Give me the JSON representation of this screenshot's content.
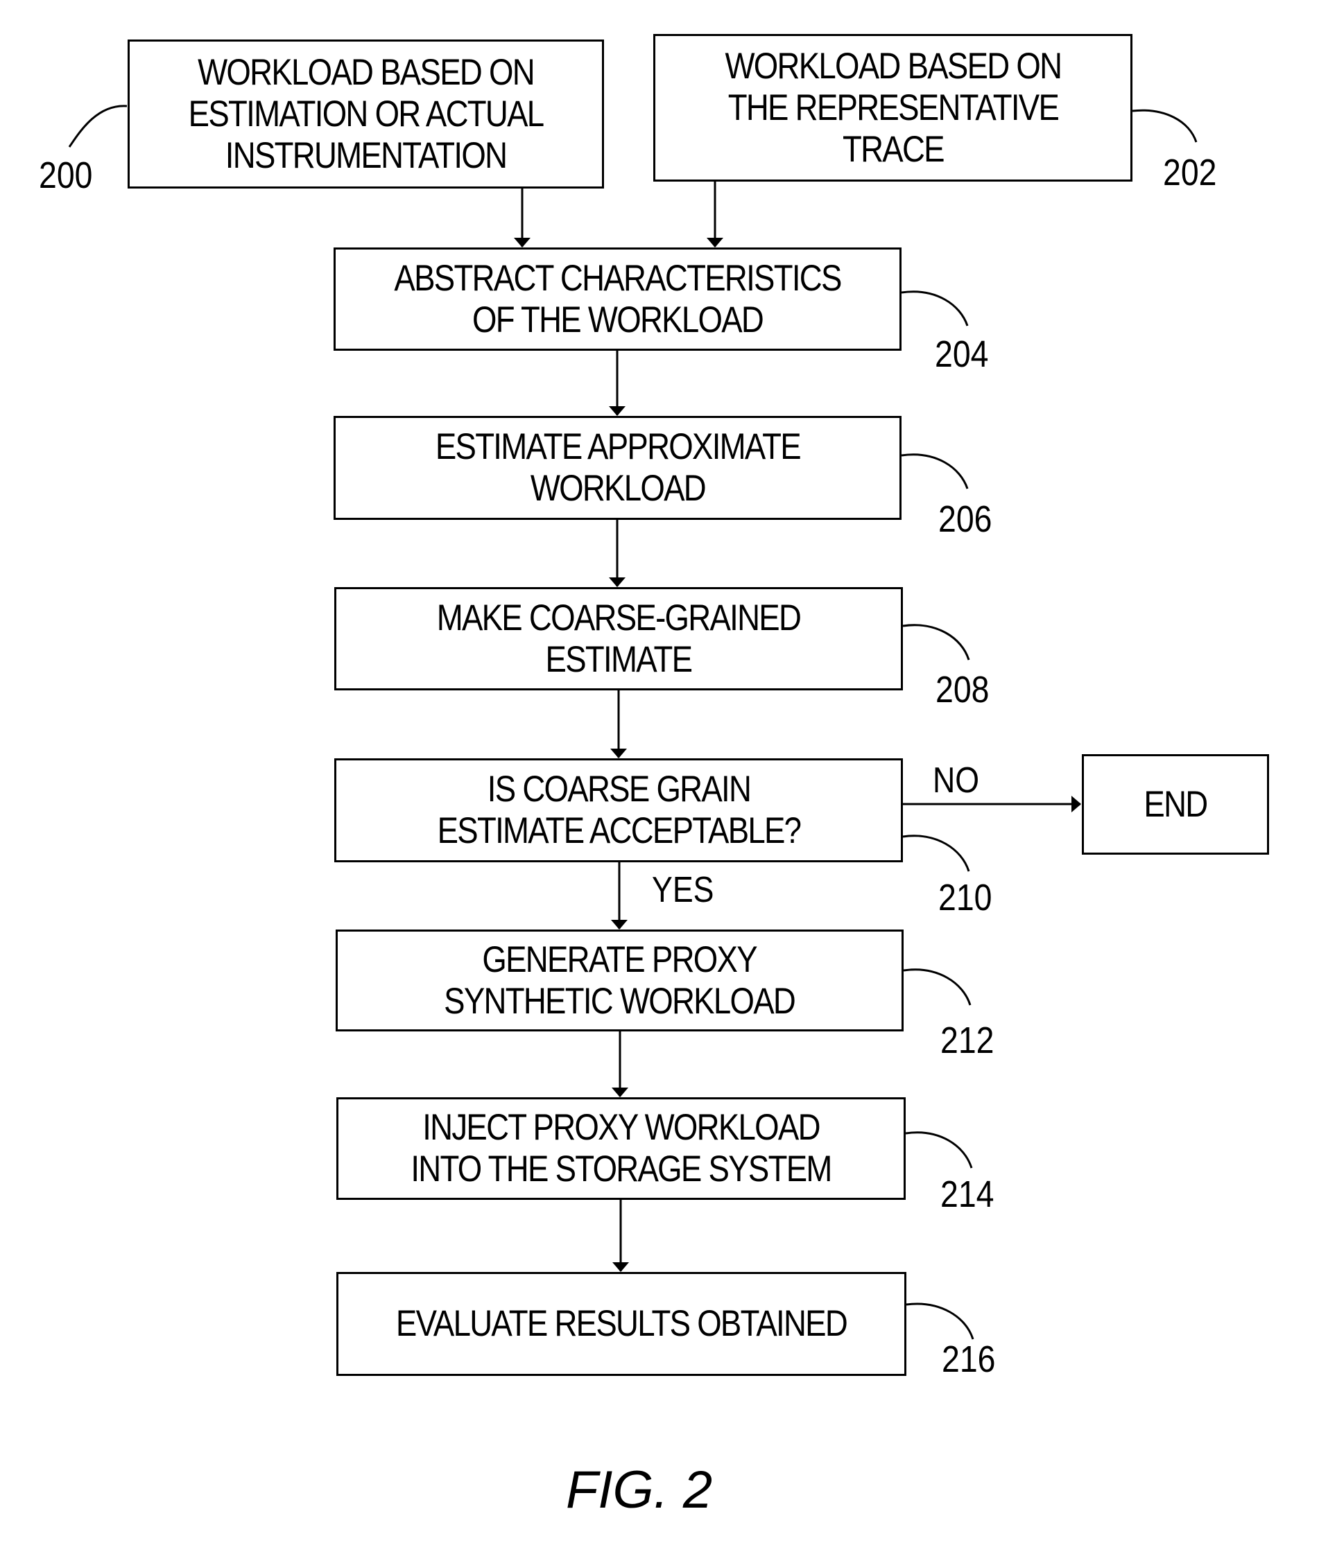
{
  "figure": {
    "caption": "FIG. 2"
  },
  "nodes": [
    {
      "id": "200",
      "label": "WORKLOAD BASED ON\nESTIMATION OR ACTUAL\nINSTRUMENTATION",
      "ref": "200",
      "type": "process"
    },
    {
      "id": "202",
      "label": "WORKLOAD BASED ON\nTHE REPRESENTATIVE\nTRACE",
      "ref": "202",
      "type": "process"
    },
    {
      "id": "204",
      "label": "ABSTRACT CHARACTERISTICS\nOF THE WORKLOAD",
      "ref": "204",
      "type": "process"
    },
    {
      "id": "206",
      "label": "ESTIMATE APPROXIMATE\nWORKLOAD",
      "ref": "206",
      "type": "process"
    },
    {
      "id": "208",
      "label": "MAKE COARSE-GRAINED\nESTIMATE",
      "ref": "208",
      "type": "process"
    },
    {
      "id": "210",
      "label": "IS COARSE GRAIN\nESTIMATE ACCEPTABLE?",
      "ref": "210",
      "type": "decision"
    },
    {
      "id": "end",
      "label": "END",
      "ref": "",
      "type": "terminal"
    },
    {
      "id": "212",
      "label": "GENERATE PROXY\nSYNTHETIC WORKLOAD",
      "ref": "212",
      "type": "process"
    },
    {
      "id": "214",
      "label": "INJECT PROXY WORKLOAD\nINTO THE STORAGE SYSTEM",
      "ref": "214",
      "type": "process"
    },
    {
      "id": "216",
      "label": "EVALUATE RESULTS OBTAINED",
      "ref": "216",
      "type": "process"
    }
  ],
  "edges": [
    {
      "from": "200",
      "to": "204",
      "label": ""
    },
    {
      "from": "202",
      "to": "204",
      "label": ""
    },
    {
      "from": "204",
      "to": "206",
      "label": ""
    },
    {
      "from": "206",
      "to": "208",
      "label": ""
    },
    {
      "from": "208",
      "to": "210",
      "label": ""
    },
    {
      "from": "210",
      "to": "end",
      "label": "NO"
    },
    {
      "from": "210",
      "to": "212",
      "label": "YES"
    },
    {
      "from": "212",
      "to": "214",
      "label": ""
    },
    {
      "from": "214",
      "to": "216",
      "label": ""
    }
  ]
}
